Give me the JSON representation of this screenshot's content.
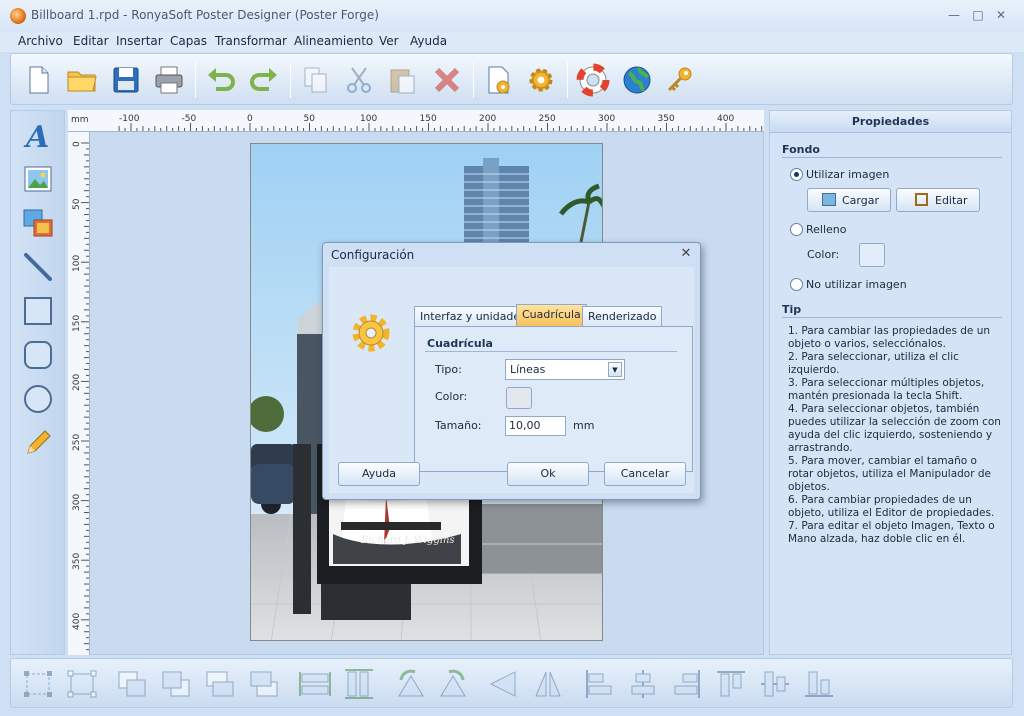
{
  "window": {
    "title": "Billboard 1.rpd - RonyaSoft Poster Designer (Poster Forge)"
  },
  "menu": [
    "Archivo",
    "Editar",
    "Insertar",
    "Capas",
    "Transformar",
    "Alineamiento",
    "Ver",
    "Ayuda"
  ],
  "toolbar": {
    "icons": [
      "new-file-icon",
      "open-folder-icon",
      "save-icon",
      "print-icon",
      "undo-icon",
      "redo-icon",
      "copy-icon",
      "cut-icon",
      "paste-icon",
      "delete-icon",
      "document-settings-icon",
      "settings-gear-icon",
      "help-lifebuoy-icon",
      "web-globe-icon",
      "key-icon"
    ]
  },
  "tools": [
    "text-tool-icon",
    "image-tool-icon",
    "images-tool-icon",
    "line-tool-icon",
    "rectangle-tool-icon",
    "rounded-rectangle-tool-icon",
    "ellipse-tool-icon",
    "pencil-tool-icon"
  ],
  "ruler": {
    "unit": "mm",
    "top_labels": [
      "-100",
      "-50",
      "0",
      "50",
      "100",
      "150",
      "200",
      "250",
      "300",
      "350",
      "400"
    ],
    "left_labels": [
      "0",
      "50",
      "100",
      "150",
      "200",
      "250",
      "300",
      "350",
      "400"
    ]
  },
  "poster": {
    "signature": "Richard J. Wiggins"
  },
  "properties": {
    "header": "Propiedades",
    "fondo_title": "Fondo",
    "utilizar_imagen": "Utilizar imagen",
    "cargar": "Cargar",
    "editar": "Editar",
    "relleno": "Relleno",
    "color": "Color:",
    "no_utilizar_imagen": "No utilizar imagen",
    "tip_title": "Tip",
    "tips": [
      "1. Para cambiar las propiedades de un objeto o varios, selecciónalos.",
      "2. Para seleccionar, utiliza el clic izquierdo.",
      "3. Para seleccionar múltiples objetos, mantén presionada la tecla Shift.",
      "4. Para seleccionar objetos, también puedes utilizar la selección de zoom con ayuda del clic izquierdo, sosteniendo y arrastrando.",
      "5. Para mover, cambiar el tamaño o rotar objetos, utiliza el Manipulador de objetos.",
      "6. Para cambiar propiedades de un objeto, utiliza el Editor de propiedades.",
      "7. Para editar el objeto Imagen, Texto o Mano alzada, haz doble clic en él."
    ]
  },
  "dialog": {
    "title": "Configuración",
    "close": "✕",
    "tabs": [
      "Interfaz y unidades",
      "Cuadrícula",
      "Renderizado"
    ],
    "active_tab": "Cuadrícula",
    "group_title": "Cuadrícula",
    "tipo_label": "Tipo:",
    "tipo_value": "Líneas",
    "color_label": "Color:",
    "size_label": "Tamaño:",
    "size_value": "10,00",
    "size_unit": "mm",
    "help_button": "Ayuda",
    "ok_button": "Ok",
    "cancel_button": "Cancelar"
  },
  "bottom_toolbar": {
    "icons": [
      "group-icon",
      "ungroup-icon",
      "bring-forward-icon",
      "send-backward-icon",
      "bring-to-front-icon",
      "send-to-back-icon",
      "same-width-icon",
      "same-height-icon",
      "rotate-left-icon",
      "rotate-right-icon",
      "flip-horizontal-icon",
      "flip-vertical-icon",
      "align-left-icon",
      "align-center-icon",
      "align-right-icon",
      "align-top-icon",
      "align-middle-icon",
      "align-bottom-icon"
    ]
  },
  "colors": {
    "accent": "#f7c25a",
    "panel": "#d4e4f6",
    "background": "#cfe0f4"
  }
}
